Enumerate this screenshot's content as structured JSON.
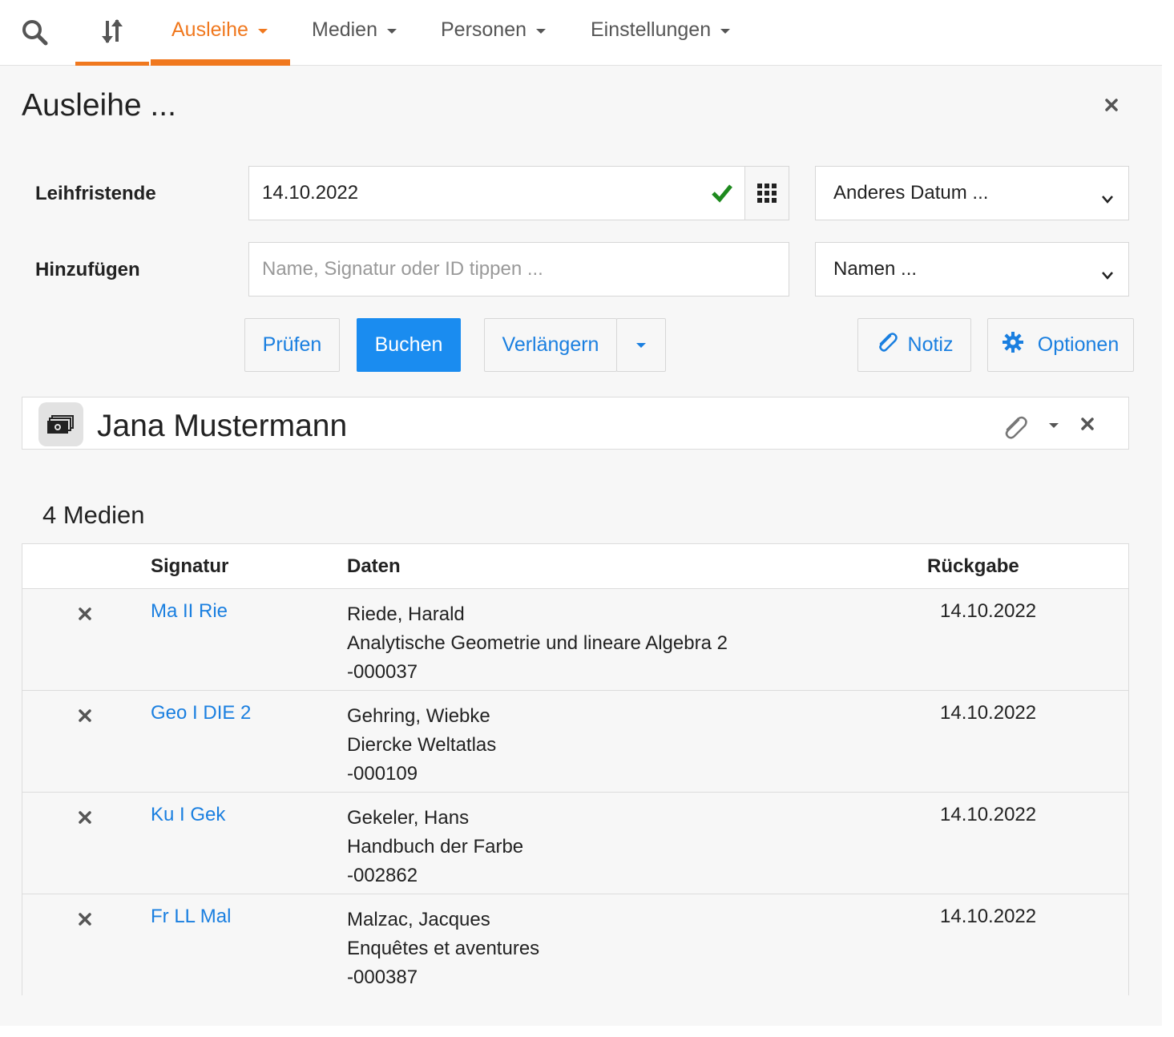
{
  "nav": {
    "items": [
      {
        "label": "Ausleihe",
        "active": true
      },
      {
        "label": "Medien",
        "active": false
      },
      {
        "label": "Personen",
        "active": false
      },
      {
        "label": "Einstellungen",
        "active": false
      }
    ],
    "icons": [
      "search-icon",
      "sort-icon"
    ],
    "accent_color": "#f0781e"
  },
  "panel": {
    "title": "Ausleihe ..."
  },
  "form": {
    "due_label": "Leihfristende",
    "due_value": "14.10.2022",
    "due_select": "Anderes Datum ...",
    "add_label": "Hinzufügen",
    "add_placeholder": "Name, Signatur oder ID tippen ...",
    "add_select": "Namen ..."
  },
  "buttons": {
    "pruefen": "Prüfen",
    "buchen": "Buchen",
    "verlaengern": "Verlängern",
    "notiz": "Notiz",
    "optionen": "Optionen",
    "primary_color": "#1a8cf0",
    "link_color": "#1a7fe0"
  },
  "person": {
    "name": "Jana Mustermann",
    "icon": "money-icon"
  },
  "media": {
    "count_label": "4 Medien",
    "headers": {
      "signatur": "Signatur",
      "daten": "Daten",
      "rueckgabe": "Rückgabe"
    },
    "rows": [
      {
        "signatur": "Ma II Rie",
        "author": "Riede, Harald",
        "title": "Analytische Geometrie und lineare Algebra 2",
        "id": "-000037",
        "return": "14.10.2022"
      },
      {
        "signatur": "Geo I DIE 2",
        "author": "Gehring, Wiebke",
        "title": "Diercke Weltatlas",
        "id": "-000109",
        "return": "14.10.2022"
      },
      {
        "signatur": "Ku I Gek",
        "author": "Gekeler, Hans",
        "title": "Handbuch der Farbe",
        "id": "-002862",
        "return": "14.10.2022"
      },
      {
        "signatur": "Fr LL Mal",
        "author": "Malzac, Jacques",
        "title": "Enquêtes et aventures",
        "id": "-000387",
        "return": "14.10.2022"
      }
    ]
  }
}
